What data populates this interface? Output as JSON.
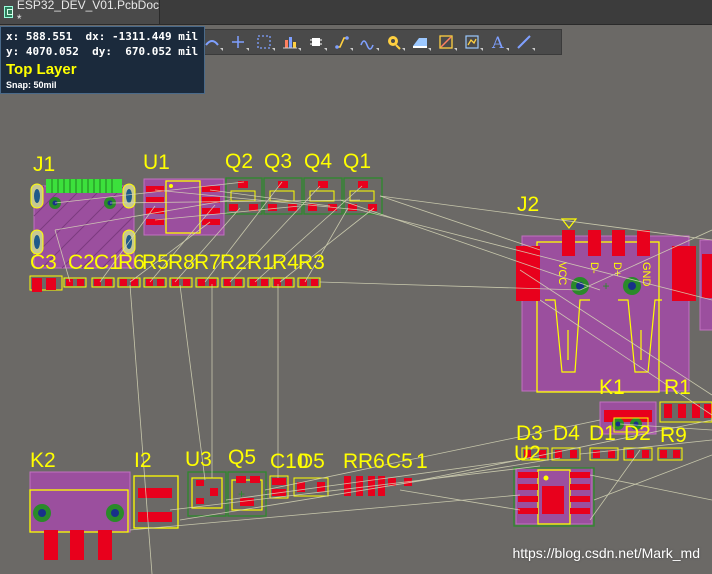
{
  "tab": {
    "title": "ESP32_DEV_V01.PcbDoc *"
  },
  "hud": {
    "x_label": "x:",
    "x_value": "588.551",
    "dx_label": "dx:",
    "dx_value": "-1311.449 mil",
    "y_label": "y:",
    "y_value": "4070.052",
    "dy_label": "dy:",
    "dy_value": "670.052 mil",
    "layer": "Top Layer",
    "snap": "Snap: 50mil"
  },
  "toolbar": {
    "items": [
      {
        "name": "route-icon",
        "color": "#7fa0ff"
      },
      {
        "name": "crosshair-icon",
        "color": "#7fa0ff"
      },
      {
        "name": "select-rect-icon",
        "color": "#7fa0ff"
      },
      {
        "name": "align-icon",
        "color": "#ff8060"
      },
      {
        "name": "component-icon",
        "color": "#ffffff"
      },
      {
        "name": "interactive-route-icon",
        "color": "#ffd040"
      },
      {
        "name": "diff-pair-icon",
        "color": "#7fa0ff"
      },
      {
        "name": "via-icon",
        "color": "#ffd040"
      },
      {
        "name": "fill-icon",
        "color": "#9cc8ff"
      },
      {
        "name": "polygon-icon",
        "color": "#ffd040"
      },
      {
        "name": "dimension-icon",
        "color": "#9cc8ff"
      },
      {
        "name": "text-icon",
        "color": "#7fa0ff"
      },
      {
        "name": "line-icon",
        "color": "#7fa0ff"
      }
    ]
  },
  "designators": [
    {
      "text": "J1"
    },
    {
      "text": "U1"
    },
    {
      "text": "Q2"
    },
    {
      "text": "Q3"
    },
    {
      "text": "Q4"
    },
    {
      "text": "Q1"
    },
    {
      "text": "J2"
    },
    {
      "text": "C3"
    },
    {
      "text": "C2"
    },
    {
      "text": "C1"
    },
    {
      "text": "R6"
    },
    {
      "text": "R5"
    },
    {
      "text": "R8"
    },
    {
      "text": "R7"
    },
    {
      "text": "R2"
    },
    {
      "text": "R1"
    },
    {
      "text": "R4"
    },
    {
      "text": "R3"
    },
    {
      "text": "K1"
    },
    {
      "text": "R1"
    },
    {
      "text": "R9"
    },
    {
      "text": "K2"
    },
    {
      "text": "I2"
    },
    {
      "text": "U3"
    },
    {
      "text": "Q5"
    },
    {
      "text": "C10"
    },
    {
      "text": "D5"
    },
    {
      "text": "R"
    },
    {
      "text": "R6"
    },
    {
      "text": "C5"
    },
    {
      "text": "1"
    },
    {
      "text": "D3"
    },
    {
      "text": "D4"
    },
    {
      "text": "D1"
    },
    {
      "text": "D2"
    },
    {
      "text": "U2"
    }
  ],
  "usb_labels": [
    "VCC",
    "D-",
    "D+",
    "GND"
  ],
  "watermark": "https://blog.csdn.net/Mark_md",
  "colors": {
    "background": "#6b6966",
    "pad": "#e8001c",
    "overlay": "#ffff00",
    "body": "#9b4f9e",
    "ratsnest": "#d8d8b8",
    "hud_bg": "#1b2a3c",
    "layer_text": "#ffff00"
  }
}
